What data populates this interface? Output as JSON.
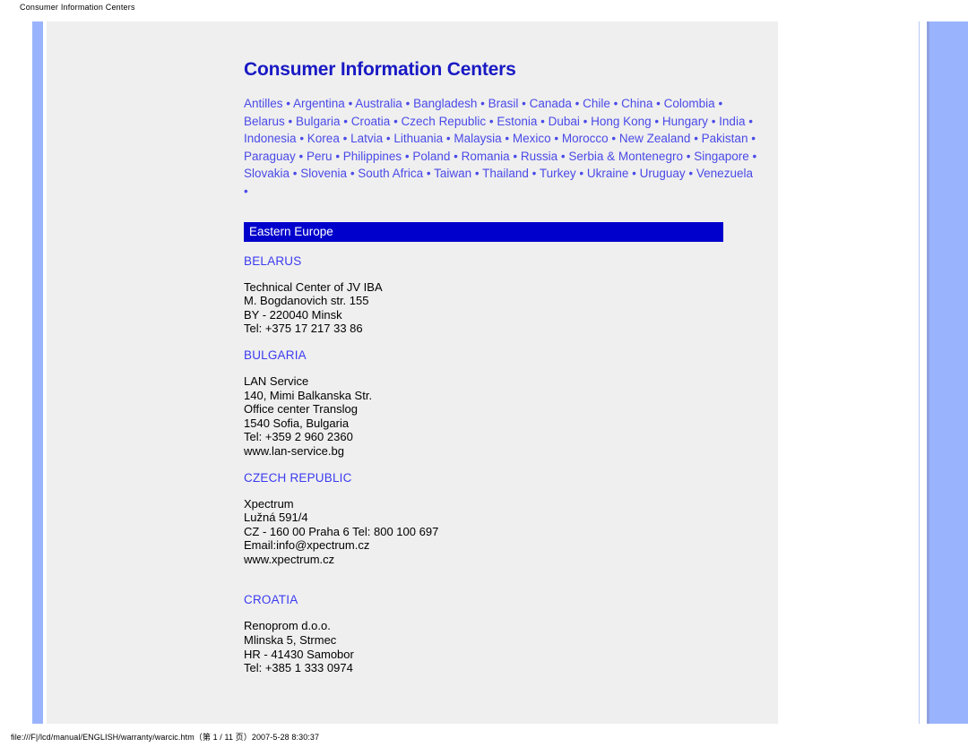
{
  "print": {
    "header_title": "Consumer Information Centers",
    "footer_text": "file:///F|/lcd/manual/ENGLISH/warranty/warcic.htm（第 1 / 11 页）2007-5-28 8:30:37"
  },
  "colors": {
    "title_blue": "#1919c4",
    "link_blue": "#4a4ae8",
    "country_blue": "#3b3bf0",
    "banner_blue": "#0000cc",
    "accent_bar": "#99b4fd",
    "content_bg": "#efefef"
  },
  "article": {
    "title": "Consumer Information Centers",
    "country_index": [
      "Antilles",
      "Argentina",
      "Australia",
      "Bangladesh",
      "Brasil",
      "Canada",
      "Chile",
      "China",
      "Colombia",
      "Belarus",
      "Bulgaria",
      "Croatia",
      "Czech Republic",
      "Estonia",
      "Dubai",
      "Hong Kong",
      "Hungary",
      "India",
      "Indonesia",
      "Korea",
      "Latvia",
      "Lithuania",
      "Malaysia",
      "Mexico",
      "Morocco",
      "New Zealand",
      "Pakistan",
      "Paraguay",
      "Peru",
      "Philippines",
      "Poland",
      "Romania",
      "Russia",
      "Serbia & Montenegro",
      "Singapore",
      "Slovakia",
      "Slovenia",
      "South Africa",
      "Taiwan",
      "Thailand",
      "Turkey",
      "Ukraine",
      "Uruguay",
      "Venezuela"
    ],
    "index_separator": "•",
    "region_heading": "Eastern Europe",
    "countries": [
      {
        "name": "BELARUS",
        "address": [
          "Technical Center of JV IBA",
          "M. Bogdanovich str. 155",
          "BY - 220040 Minsk",
          "Tel: +375 17 217 33 86"
        ]
      },
      {
        "name": "BULGARIA",
        "address": [
          "LAN Service",
          "140, Mimi Balkanska Str.",
          "Office center Translog",
          "1540 Sofia, Bulgaria",
          "Tel: +359 2 960 2360",
          "www.lan-service.bg"
        ]
      },
      {
        "name": "CZECH REPUBLIC",
        "address": [
          "Xpectrum",
          "Lužná 591/4",
          "CZ - 160 00 Praha 6 Tel: 800 100 697",
          "Email:info@xpectrum.cz",
          "www.xpectrum.cz"
        ]
      },
      {
        "name": "CROATIA",
        "address": [
          "Renoprom d.o.o.",
          "Mlinska 5, Strmec",
          "HR - 41430 Samobor",
          "Tel: +385 1 333 0974"
        ]
      }
    ]
  }
}
